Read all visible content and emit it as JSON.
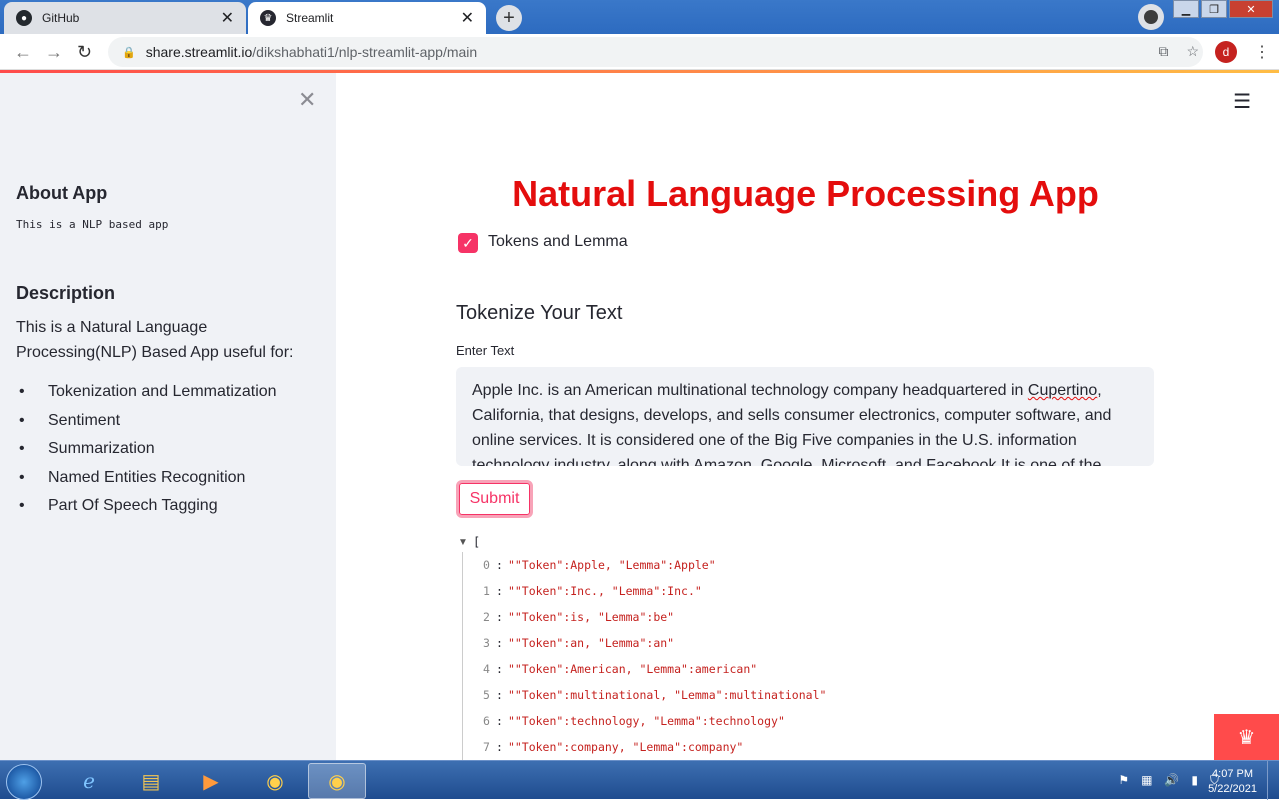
{
  "browser": {
    "tabs": [
      {
        "label": "GitHub",
        "icon": "github-icon"
      },
      {
        "label": "Streamlit",
        "icon": "streamlit-icon"
      }
    ],
    "url_host": "share.streamlit.io",
    "url_path": "/dikshabhati1/nlp-streamlit-app/main",
    "profile_initial": "d"
  },
  "sidebar": {
    "about_heading": "About App",
    "about_text": "This is a NLP based app",
    "description_heading": "Description",
    "description_text": "This is a Natural Language Processing(NLP) Based App useful for:",
    "features": [
      "Tokenization and Lemmatization",
      "Sentiment",
      "Summarization",
      "Named Entities Recognition",
      "Part Of Speech Tagging"
    ]
  },
  "main": {
    "title": "Natural Language Processing App",
    "checkbox_label": "Tokens and Lemma",
    "checkbox_checked": true,
    "subheader": "Tokenize Your Text",
    "input_label": "Enter Text",
    "text_before": "Apple Inc. is an American multinational technology company headquartered in ",
    "text_spell": "Cupertino",
    "text_after": ", California, that designs, develops, and sells consumer electronics, computer software, and online services. It is considered one of the Big Five companies in the U.S. information technology industry, along with Amazon, Google, Microsoft, and Facebook.It is one of the",
    "submit_label": "Submit",
    "json_open": "[",
    "json_rows": [
      {
        "index": "0",
        "value": "\"\"Token\":Apple, \"Lemma\":Apple\""
      },
      {
        "index": "1",
        "value": "\"\"Token\":Inc., \"Lemma\":Inc.\""
      },
      {
        "index": "2",
        "value": "\"\"Token\":is, \"Lemma\":be\""
      },
      {
        "index": "3",
        "value": "\"\"Token\":an, \"Lemma\":an\""
      },
      {
        "index": "4",
        "value": "\"\"Token\":American, \"Lemma\":american\""
      },
      {
        "index": "5",
        "value": "\"\"Token\":multinational, \"Lemma\":multinational\""
      },
      {
        "index": "6",
        "value": "\"\"Token\":technology, \"Lemma\":technology\""
      },
      {
        "index": "7",
        "value": "\"\"Token\":company, \"Lemma\":company\""
      }
    ]
  },
  "taskbar": {
    "time": "4:07 PM",
    "date": "5/22/2021"
  },
  "colors": {
    "title_red": "#e40d0d",
    "streamlit_pink": "#f63366",
    "sidebar_bg": "#f0f2f6"
  }
}
